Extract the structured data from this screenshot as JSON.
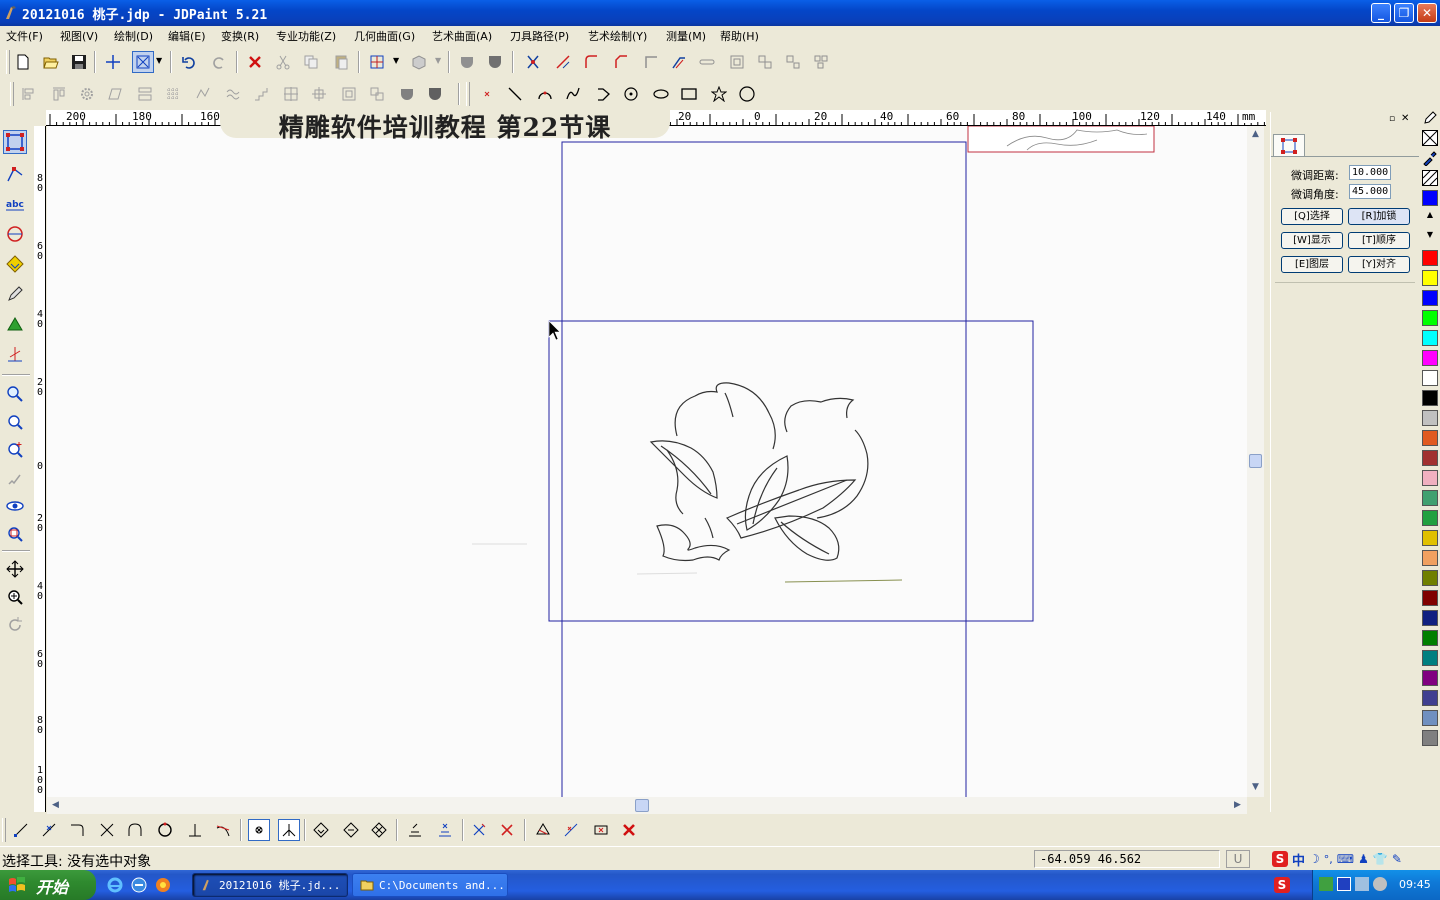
{
  "window": {
    "title": "20121016 桃子.jdp - JDPaint 5.21"
  },
  "menu": [
    "文件(F)",
    "视图(V)",
    "绘制(D)",
    "编辑(E)",
    "变换(R)",
    "专业功能(Z)",
    "几何曲面(G)",
    "艺术曲面(A)",
    "刀具路径(P)",
    "艺术绘制(Y)",
    "测量(M)",
    "帮助(H)"
  ],
  "ruler": {
    "top_labels": [
      "200",
      "180",
      "160",
      "20",
      "0",
      "20",
      "40",
      "60",
      "80",
      "100",
      "120",
      "140"
    ],
    "unit": "mm",
    "left_labels": [
      "8\n0",
      "6\n0",
      "4\n0",
      "2\n0",
      "0",
      "2\n0",
      "4\n0",
      "6\n0",
      "8\n0",
      "1\n0\n0"
    ]
  },
  "banner": {
    "text": "精雕软件培训教程  第22节课"
  },
  "right_panel": {
    "fine_distance_label": "微调距离:",
    "fine_distance_value": "10.000",
    "fine_angle_label": "微调角度:",
    "fine_angle_value": "45.000",
    "buttons": [
      {
        "label": "[Q]选择"
      },
      {
        "label": "[R]加锁"
      },
      {
        "label": "[W]显示"
      },
      {
        "label": "[T]顺序"
      },
      {
        "label": "[E]图层"
      },
      {
        "label": "[Y]对齐"
      }
    ]
  },
  "palette_colors": [
    "#0000ff",
    "#ff0000",
    "#ffff00",
    "#0000ff",
    "#00ff00",
    "#00ffff",
    "#ff00ff",
    "#ffffff",
    "#000000",
    "#c0c0c0",
    "#e05a20",
    "#a03030",
    "#f0b0c0",
    "#40a070",
    "#20a040",
    "#e0c000",
    "#f0a060",
    "#708000",
    "#800000",
    "#102080",
    "#008000",
    "#008080",
    "#800080",
    "#404090",
    "#7090c0",
    "#808080"
  ],
  "status": {
    "text": "选择工具: 没有选中对象",
    "coords": "-64.059  46.562",
    "caps": "U"
  },
  "taskbar": {
    "start": "开始",
    "tasks": [
      {
        "label": "20121016 桃子.jd..."
      },
      {
        "label": "C:\\Documents and..."
      }
    ],
    "ime": "中",
    "time": "09:45"
  }
}
